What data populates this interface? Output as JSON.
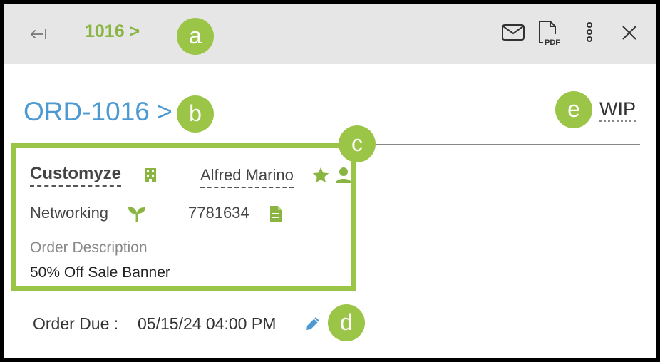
{
  "header": {
    "breadcrumb": "1016 >"
  },
  "toolbar": {
    "back_icon": "collapse-left-icon",
    "email_icon": "email-icon",
    "pdf_icon": "pdf-icon",
    "pdf_label": "PDF",
    "more_icon": "more-vertical-icon",
    "close_icon": "close-icon"
  },
  "order": {
    "title": "ORD-1016 >",
    "status": "WIP"
  },
  "details": {
    "company": "Customyze",
    "company_icon": "building-icon",
    "contact": "Alfred Marino",
    "contact_icons": [
      "star-icon",
      "person-icon"
    ],
    "industry": "Networking",
    "industry_icon": "sprout-icon",
    "order_number": "7781634",
    "order_number_icon": "document-icon",
    "description_label": "Order Description",
    "description": "50% Off Sale Banner"
  },
  "due": {
    "label": "Order Due :",
    "value": "05/15/24 04:00 PM",
    "edit_icon": "pencil-icon"
  },
  "callouts": {
    "a": "a",
    "b": "b",
    "c": "c",
    "d": "d",
    "e": "e"
  },
  "colors": {
    "accent_green": "#9bc547",
    "link_blue": "#4d9ad2",
    "toolbar_bg": "#e6e6e6",
    "icon_green": "#8ab543"
  }
}
